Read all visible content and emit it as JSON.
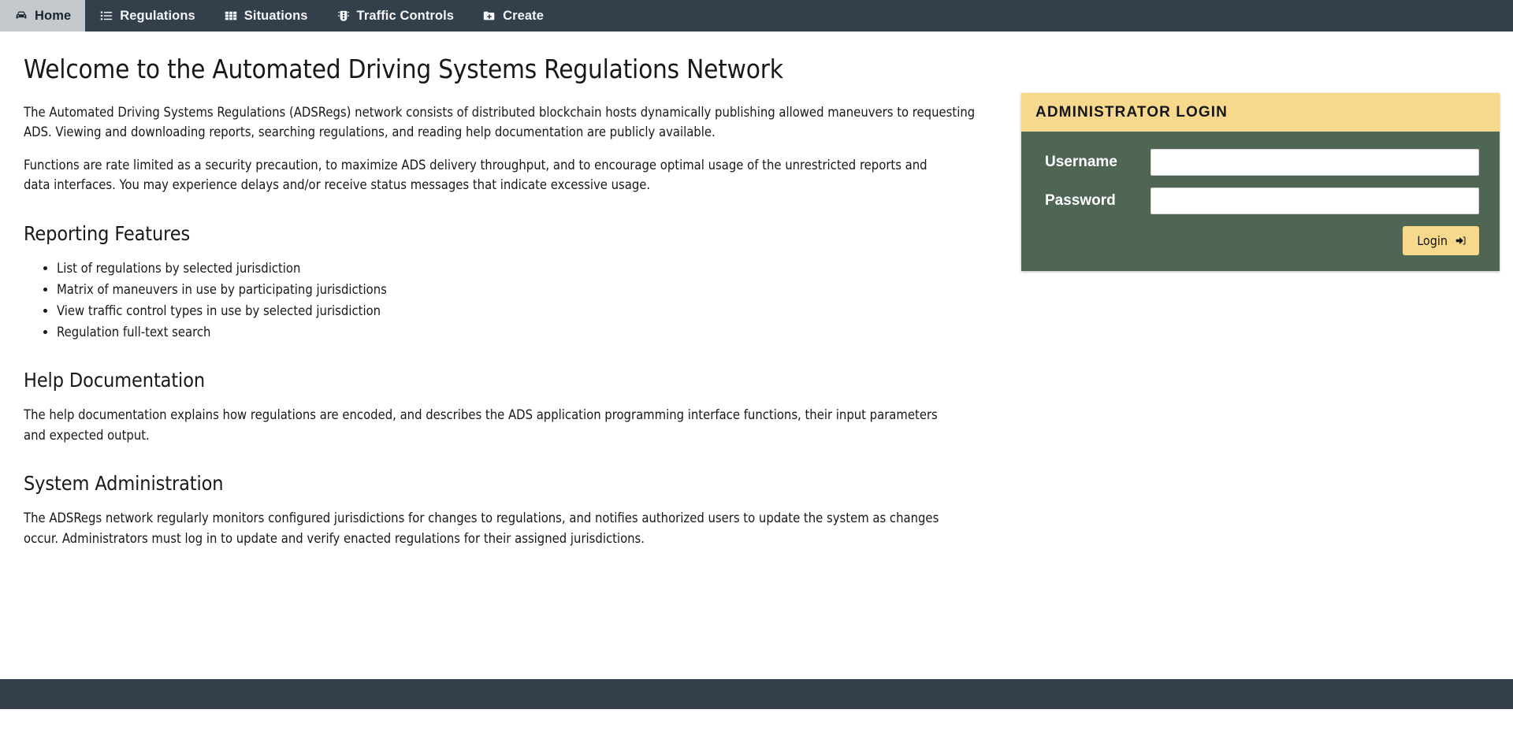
{
  "navbar": {
    "items": [
      {
        "label": "Home",
        "icon": "car-icon",
        "active": true
      },
      {
        "label": "Regulations",
        "icon": "list-icon",
        "active": false
      },
      {
        "label": "Situations",
        "icon": "grid-icon",
        "active": false
      },
      {
        "label": "Traffic Controls",
        "icon": "traffic-light-icon",
        "active": false
      },
      {
        "label": "Create",
        "icon": "folder-plus-icon",
        "active": false
      }
    ]
  },
  "main": {
    "page_title": "Welcome to the Automated Driving Systems Regulations Network",
    "intro_paragraph_1": "The Automated Driving Systems Regulations (ADSRegs) network consists of distributed blockchain hosts dynamically publishing allowed maneuvers to requesting ADS. Viewing and downloading reports, searching regulations, and reading help documentation are publicly available.",
    "intro_paragraph_2": "Functions are rate limited as a security precaution, to maximize ADS delivery throughput, and to encourage optimal usage of the unrestricted reports and data interfaces. You may experience delays and/or receive status messages that indicate excessive usage.",
    "reporting": {
      "heading": "Reporting Features",
      "items": [
        "List of regulations by selected jurisdiction",
        "Matrix of maneuvers in use by participating jurisdictions",
        "View traffic control types in use by selected jurisdiction",
        "Regulation full-text search"
      ]
    },
    "help": {
      "heading": "Help Documentation",
      "paragraph": "The help documentation explains how regulations are encoded, and describes the ADS application programming interface functions, their input parameters and expected output."
    },
    "administration": {
      "heading": "System Administration",
      "paragraph": "The ADSRegs network regularly monitors configured jurisdictions for changes to regulations, and notifies authorized users to update the system as changes occur. Administrators must log in to update and verify enacted regulations for their assigned jurisdictions."
    }
  },
  "login": {
    "title": "ADMINISTRATOR LOGIN",
    "username_label": "Username",
    "username_value": "",
    "username_placeholder": "",
    "password_label": "Password",
    "password_value": "",
    "password_placeholder": "",
    "submit_label": "Login",
    "submit_icon": "sign-in-icon"
  },
  "colors": {
    "navbar_bg": "#343f4c",
    "nav_active_bg": "#c4c9cd",
    "panel_header_bg": "#f6d98c",
    "panel_body_bg": "#4f6655",
    "button_bg": "#f6d98c",
    "footer_bg": "#343f4c",
    "text": "#17181a"
  }
}
